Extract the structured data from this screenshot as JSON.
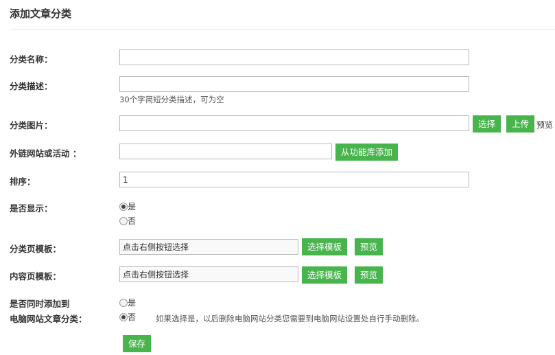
{
  "page": {
    "title": "添加文章分类"
  },
  "fields": {
    "name": {
      "label": "分类名称：",
      "value": ""
    },
    "description": {
      "label": "分类描述：",
      "value": "",
      "hint": "30个字简短分类描述，可为空"
    },
    "image": {
      "label": "分类图片：",
      "value": "",
      "select_label": "选择",
      "upload_label": "上传",
      "preview_text": "预览"
    },
    "external_link": {
      "label": "外链网站或活动 ：",
      "value": "",
      "button_label": "从功能库添加"
    },
    "sort": {
      "label": "排序：",
      "value": "1"
    },
    "visible": {
      "label": "是否显示：",
      "options": [
        "是",
        "否"
      ],
      "selected": "是"
    },
    "category_template": {
      "label": "分类页模板：",
      "value": "点击右侧按钮选择",
      "select_label": "选择模板",
      "preview_label": "预览"
    },
    "content_template": {
      "label": "内容页模板：",
      "value": "点击右侧按钮选择",
      "select_label": "选择模板",
      "preview_label": "预览"
    },
    "sync_pc": {
      "label_line1": "是否同时添加到",
      "label_line2": "电脑网站文章分类：",
      "options": [
        "是",
        "否"
      ],
      "selected": "否",
      "hint": "如果选择是，以后删除电脑网站分类您需要到电脑网站设置处自行手动删除。"
    }
  },
  "actions": {
    "save_label": "保存"
  },
  "colors": {
    "button_green": "#47b44c",
    "divider": "#e6e6e6"
  }
}
